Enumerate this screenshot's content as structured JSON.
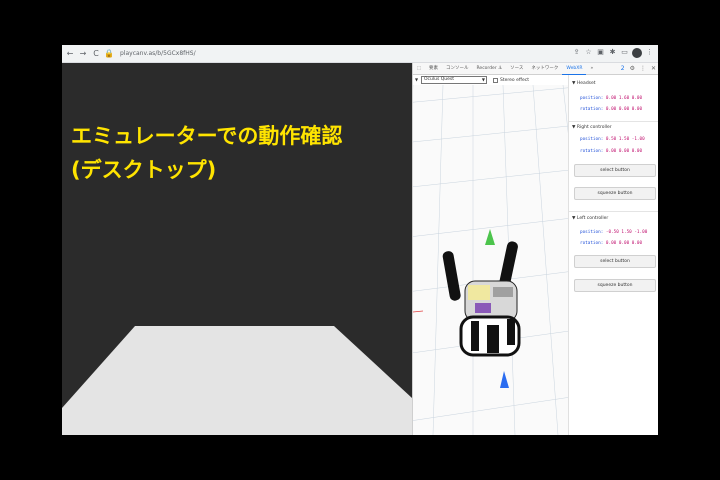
{
  "browser": {
    "url": "playcanv.as/b/5GCx8fHS/",
    "nav_back": "←",
    "nav_forward": "→",
    "nav_reload": "C"
  },
  "app": {
    "title_line1": "エミュレーターでの動作確認",
    "title_line2": "(デスクトップ)",
    "title_color": "#ffe400",
    "background_color": "#2b2b2b"
  },
  "devtools": {
    "tabs": [
      "要素",
      "コンソール",
      "Recorder ⚓",
      "ソース",
      "ネットワーク",
      "WebXR",
      "»"
    ],
    "active_tab": "WebXR",
    "badge": "2",
    "device_select": "Oculus Quest",
    "stereo_label": "Stereo effect",
    "headset": {
      "header": "Headset",
      "position_label": "position:",
      "position_value": "0.00 1.60 0.00",
      "rotation_label": "rotation:",
      "rotation_value": "0.00 0.00 0.00"
    },
    "right_controller": {
      "header": "Right controller",
      "position_label": "position:",
      "position_value": "0.50 1.50 -1.00",
      "rotation_label": "rotation:",
      "rotation_value": "0.00 0.00 0.00",
      "select_button": "select button",
      "squeeze_button": "squeeze button"
    },
    "left_controller": {
      "header": "Left controller",
      "position_label": "position:",
      "position_value": "-0.50 1.50 -1.00",
      "rotation_label": "rotation:",
      "rotation_value": "0.00 0.00 0.00",
      "select_button": "select button",
      "squeeze_button": "squeeze button"
    }
  }
}
